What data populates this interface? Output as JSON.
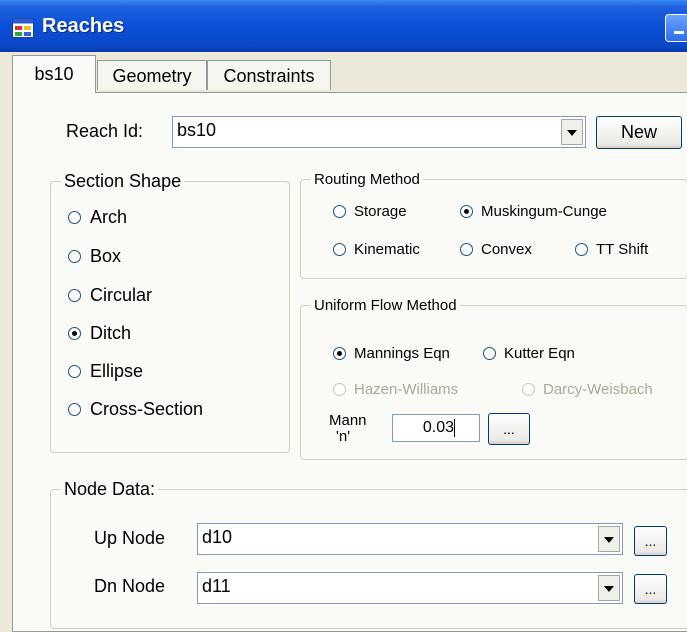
{
  "window": {
    "title": "Reaches"
  },
  "tabs": [
    {
      "label": "bs10",
      "active": true
    },
    {
      "label": "Geometry",
      "active": false
    },
    {
      "label": "Constraints",
      "active": false
    }
  ],
  "reach": {
    "label": "Reach Id:",
    "value": "bs10",
    "new_button": "New"
  },
  "section_shape": {
    "title": "Section Shape",
    "options": [
      "Arch",
      "Box",
      "Circular",
      "Ditch",
      "Ellipse",
      "Cross-Section"
    ],
    "selected": "Ditch"
  },
  "routing_method": {
    "title": "Routing Method",
    "options": [
      "Storage",
      "Muskingum-Cunge",
      "Kinematic",
      "Convex",
      "TT Shift"
    ],
    "selected": "Muskingum-Cunge"
  },
  "uniform_flow": {
    "title": "Uniform Flow Method",
    "options": [
      "Mannings Eqn",
      "Kutter Eqn",
      "Hazen-Williams",
      "Darcy-Weisbach"
    ],
    "selected": "Mannings Eqn",
    "disabled": [
      "Hazen-Williams",
      "Darcy-Weisbach"
    ],
    "mann_label_1": "Mann",
    "mann_label_2": "'n'",
    "mann_value": "0.03",
    "browse_label": "..."
  },
  "node_data": {
    "title": "Node Data:",
    "up_label": "Up Node",
    "up_value": "d10",
    "dn_label": "Dn Node",
    "dn_value": "d11",
    "browse_label": "..."
  },
  "colors": {
    "titlebar": "#0b4fd8",
    "face": "#ece9d8",
    "panel": "#fafaf7"
  }
}
